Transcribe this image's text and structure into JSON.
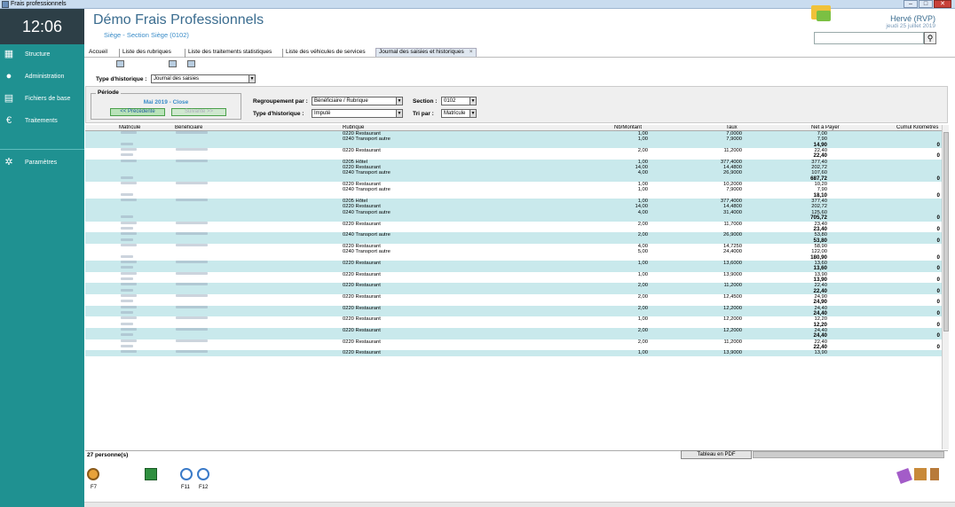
{
  "window": {
    "title": "Frais professionnels"
  },
  "clock": "12:06",
  "sidebar": {
    "items": [
      {
        "label": "Structure",
        "icon": "building-icon"
      },
      {
        "label": "Administration",
        "icon": "user-icon"
      },
      {
        "label": "Fichiers de base",
        "icon": "folder-icon"
      },
      {
        "label": "Traitements",
        "icon": "euro-icon"
      },
      {
        "label": "Paramètres",
        "icon": "gear-icon"
      }
    ]
  },
  "header": {
    "title": "Démo Frais Professionnels",
    "subtitle": "Siège - Section Siège (0102)",
    "user": "Hervé (RVP)",
    "date": "jeudi 25 juillet 2019"
  },
  "tabs": [
    {
      "label": "Accueil"
    },
    {
      "label": "Liste des rubriques"
    },
    {
      "label": "Liste des traitements statistiques"
    },
    {
      "label": "Liste des véhicules de services"
    },
    {
      "label": "Journal des saisies et historiques",
      "close": "×"
    }
  ],
  "history": {
    "label": "Type d'historique :",
    "value": "Journal des saisies"
  },
  "periode": {
    "label": "Période",
    "value": "Mai 2019 - Close",
    "prev": "<< Précédente",
    "next": "Suivante >>"
  },
  "filters": {
    "regroupement_label": "Regroupement par :",
    "regroupement_value": "Bénéficiaire / Rubrique",
    "type_label": "Type d'historique :",
    "type_value": "Imputé",
    "section_label": "Section :",
    "section_value": "0102",
    "tri_label": "Tri par :",
    "tri_value": "Matricule"
  },
  "grid": {
    "columns": [
      "Matricule",
      "Bénéficiaire",
      "Rubrique",
      "Nb/Montant",
      "Taux",
      "Net à Payer",
      "Cumul Kilomètres"
    ],
    "rows": [
      {
        "r": "0220 Restaurant",
        "n": "1,00",
        "t": "7,0000",
        "p": "7,00",
        "alt": true,
        "m": 1,
        "bn": 1
      },
      {
        "r": "0240 Transport autre",
        "n": "1,00",
        "t": "7,9000",
        "p": "7,90",
        "alt": true
      },
      {
        "p": "14,90",
        "bold": true,
        "c": "0",
        "alt": true,
        "tot": 1
      },
      {
        "r": "0220 Restaurant",
        "n": "2,00",
        "t": "11,2000",
        "p": "22,40",
        "m": 1,
        "bn": 1
      },
      {
        "p": "22,40",
        "bold": true,
        "c": "0",
        "tot": 1
      },
      {
        "r": "0205 Hôtel",
        "n": "1,00",
        "t": "377,4000",
        "p": "377,40",
        "alt": true,
        "m": 1,
        "bn": 1
      },
      {
        "r": "0220 Restaurant",
        "n": "14,00",
        "t": "14,4800",
        "p": "202,72",
        "alt": true
      },
      {
        "r": "0240 Transport autre",
        "n": "4,00",
        "t": "26,9000",
        "p": "107,60",
        "alt": true
      },
      {
        "p": "687,72",
        "bold": true,
        "c": "0",
        "alt": true,
        "tot": 1
      },
      {
        "r": "0220 Restaurant",
        "n": "1,00",
        "t": "10,2000",
        "p": "10,20",
        "m": 1,
        "bn": 1
      },
      {
        "r": "0240 Transport autre",
        "n": "1,00",
        "t": "7,9000",
        "p": "7,90"
      },
      {
        "p": "18,10",
        "bold": true,
        "c": "0",
        "tot": 1
      },
      {
        "r": "0205 Hôtel",
        "n": "1,00",
        "t": "377,4000",
        "p": "377,40",
        "alt": true,
        "m": 1,
        "bn": 1
      },
      {
        "r": "0220 Restaurant",
        "n": "14,00",
        "t": "14,4800",
        "p": "202,72",
        "alt": true
      },
      {
        "r": "0240 Transport autre",
        "n": "4,00",
        "t": "31,4000",
        "p": "125,60",
        "alt": true
      },
      {
        "p": "705,72",
        "bold": true,
        "c": "0",
        "alt": true,
        "tot": 1
      },
      {
        "r": "0220 Restaurant",
        "n": "2,00",
        "t": "11,7000",
        "p": "23,40",
        "m": 1,
        "bn": 1
      },
      {
        "p": "23,40",
        "bold": true,
        "c": "0",
        "tot": 1
      },
      {
        "r": "0240 Transport autre",
        "n": "2,00",
        "t": "26,9000",
        "p": "53,80",
        "alt": true,
        "m": 1,
        "bn": 1
      },
      {
        "p": "53,80",
        "bold": true,
        "c": "0",
        "alt": true,
        "tot": 1
      },
      {
        "r": "0220 Restaurant",
        "n": "4,00",
        "t": "14,7250",
        "p": "58,90",
        "m": 1,
        "bn": 1
      },
      {
        "r": "0240 Transport autre",
        "n": "5,00",
        "t": "24,4000",
        "p": "122,00"
      },
      {
        "p": "180,90",
        "bold": true,
        "c": "0",
        "tot": 1
      },
      {
        "r": "0220 Restaurant",
        "n": "1,00",
        "t": "13,6000",
        "p": "13,60",
        "alt": true,
        "m": 1,
        "bn": 1
      },
      {
        "p": "13,60",
        "bold": true,
        "c": "0",
        "alt": true,
        "tot": 1
      },
      {
        "r": "0220 Restaurant",
        "n": "1,00",
        "t": "13,9000",
        "p": "13,90",
        "m": 1,
        "bn": 1
      },
      {
        "p": "13,90",
        "bold": true,
        "c": "0",
        "tot": 1
      },
      {
        "r": "0220 Restaurant",
        "n": "2,00",
        "t": "11,2000",
        "p": "22,40",
        "alt": true,
        "m": 1,
        "bn": 1
      },
      {
        "p": "22,40",
        "bold": true,
        "c": "0",
        "alt": true,
        "tot": 1
      },
      {
        "r": "0220 Restaurant",
        "n": "2,00",
        "t": "12,4500",
        "p": "24,90",
        "m": 1,
        "bn": 1
      },
      {
        "p": "24,90",
        "bold": true,
        "c": "0",
        "tot": 1
      },
      {
        "r": "0220 Restaurant",
        "n": "2,00",
        "t": "12,2000",
        "p": "24,40",
        "alt": true,
        "m": 1,
        "bn": 1
      },
      {
        "p": "24,40",
        "bold": true,
        "c": "0",
        "alt": true,
        "tot": 1
      },
      {
        "r": "0220 Restaurant",
        "n": "1,00",
        "t": "12,2000",
        "p": "12,20",
        "m": 1,
        "bn": 1
      },
      {
        "p": "12,20",
        "bold": true,
        "c": "0",
        "tot": 1
      },
      {
        "r": "0220 Restaurant",
        "n": "2,00",
        "t": "12,2000",
        "p": "24,40",
        "alt": true,
        "m": 1,
        "bn": 1
      },
      {
        "p": "24,40",
        "bold": true,
        "c": "0",
        "alt": true,
        "tot": 1
      },
      {
        "r": "0220 Restaurant",
        "n": "2,00",
        "t": "11,2000",
        "p": "22,40",
        "m": 1,
        "bn": 1
      },
      {
        "p": "22,40",
        "bold": true,
        "c": "0",
        "tot": 1
      },
      {
        "r": "0220 Restaurant",
        "n": "1,00",
        "t": "13,9000",
        "p": "13,90",
        "alt": true,
        "m": 1,
        "bn": 1
      }
    ]
  },
  "footer": {
    "count": "27 personne(s)",
    "pdf": "Tableau en PDF",
    "f7": "F7",
    "f11": "F11",
    "f12": "F12"
  }
}
